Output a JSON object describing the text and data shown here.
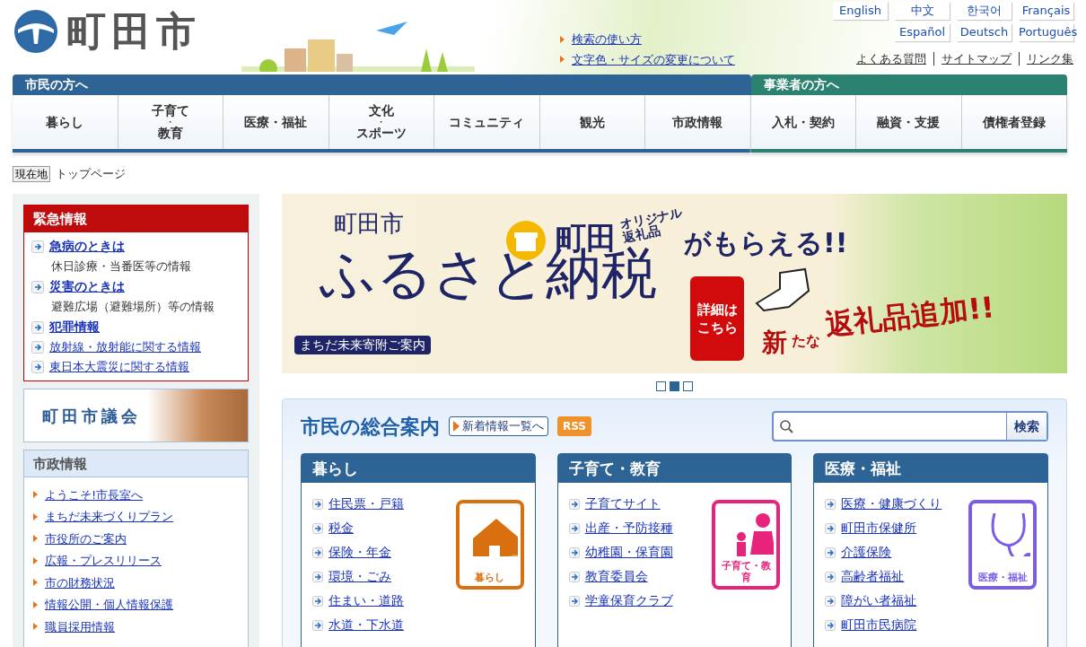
{
  "header": {
    "logo": "町田市",
    "help_links": [
      "検索の使い方",
      "文字色・サイズの変更について"
    ],
    "languages": [
      "English",
      "中文",
      "한국어",
      "Français",
      "Español",
      "Deutsch",
      "Português"
    ],
    "util_links": [
      "よくある質問",
      "サイトマップ",
      "リンク集"
    ]
  },
  "nav": {
    "groups": [
      {
        "label": "市民の方へ",
        "color": "#2e6395",
        "items": [
          [
            "暮らし"
          ],
          [
            "子育て",
            "・",
            "教育"
          ],
          [
            "医療・福祉"
          ],
          [
            "文化",
            "・",
            "スポーツ"
          ],
          [
            "コミュニティ"
          ],
          [
            "観光"
          ],
          [
            "市政情報"
          ]
        ]
      },
      {
        "label": "事業者の方へ",
        "color": "#2b8270",
        "items": [
          [
            "入札・契約"
          ],
          [
            "融資・支援"
          ],
          [
            "債権者登録"
          ]
        ]
      }
    ]
  },
  "breadcrumb": {
    "label": "現在地",
    "current": "トップページ"
  },
  "emergency": {
    "title": "緊急情報",
    "items": [
      {
        "link": "急病のときは",
        "note": "休日診療・当番医等の情報",
        "kind": "major"
      },
      {
        "link": "災害のときは",
        "note": "避難広場（避難場所）等の情報",
        "kind": "major"
      },
      {
        "link": "犯罪情報",
        "kind": "major"
      },
      {
        "link": "放射線・放射能に関する情報",
        "kind": "minor"
      },
      {
        "link": "東日本大震災に関する情報",
        "kind": "minor"
      }
    ]
  },
  "council_banner": {
    "text": "町田市議会"
  },
  "city_info": {
    "title": "市政情報",
    "links": [
      "ようこそ!市長室へ",
      "まちだ未来づくりプラン",
      "市役所のご案内",
      "広報・プレスリリース",
      "市の財務状況",
      "情報公開・個人情報保護",
      "職員採用情報"
    ]
  },
  "banner": {
    "city": "町田市",
    "title": "ふるさと納税",
    "subtitle": "まちだ未来寄附ご案内",
    "brand": "町田",
    "tag_lines": [
      "オリジナル",
      "返礼品"
    ],
    "headline": "がもらえる!!",
    "detail_button": "詳細はこちら",
    "new_small": "新",
    "new_kana": "たな",
    "new_main": "返礼品追加!!",
    "dots": [
      {
        "selected": false
      },
      {
        "selected": true
      },
      {
        "selected": false
      }
    ]
  },
  "guide": {
    "title": "市民の総合案内",
    "news_button": "新着情報一覧へ",
    "rss": "RSS",
    "search_button": "検索",
    "categories": [
      {
        "title": "暮らし",
        "icon_label": "暮らし",
        "kind": "house",
        "color": "#d9700f",
        "links": [
          "住民票・戸籍",
          "税金",
          "保険・年金",
          "環境・ごみ",
          "住まい・道路",
          "水道・下水道"
        ]
      },
      {
        "title": "子育て・教育",
        "icon_label": "子育て・教育",
        "kind": "family",
        "color": "#e8237c",
        "links": [
          "子育てサイト",
          "出産・予防接種",
          "幼稚園・保育園",
          "教育委員会",
          "学童保育クラブ"
        ]
      },
      {
        "title": "医療・福祉",
        "icon_label": "医療・福祉",
        "kind": "stethoscope",
        "color": "#7a5ce6",
        "links": [
          "医療・健康づくり",
          "町田市保健所",
          "介護保険",
          "高齢者福祉",
          "障がい者福祉",
          "町田市民病院"
        ]
      }
    ]
  }
}
